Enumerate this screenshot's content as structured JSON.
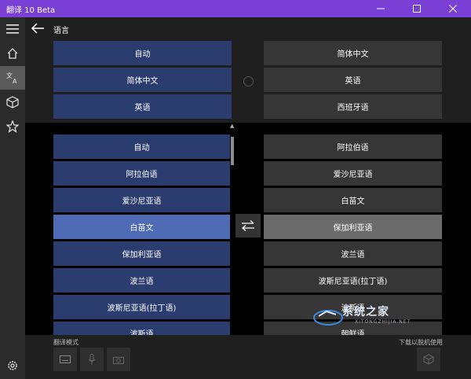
{
  "window": {
    "title": "翻译 10 Beta"
  },
  "header": {
    "title": "语言"
  },
  "top": {
    "source": [
      "自动",
      "简体中文",
      "英语"
    ],
    "target": [
      "简体中文",
      "英语",
      "西班牙语"
    ]
  },
  "source_list": {
    "items": [
      "自动",
      "阿拉伯语",
      "爱沙尼亚语",
      "白苗文",
      "保加利亚语",
      "波兰语",
      "波斯尼亚语(拉丁语)",
      "波斯语"
    ],
    "selected": "白苗文"
  },
  "target_list": {
    "items": [
      "阿拉伯语",
      "爱沙尼亚语",
      "白苗文",
      "保加利亚语",
      "波兰语",
      "波斯尼亚语(拉丁语)",
      "波斯语",
      "朝鲜语"
    ],
    "selected": "保加利亚语"
  },
  "bottom": {
    "mode_label": "翻译模式",
    "download_label": "下载以脱机使用"
  },
  "watermark": {
    "text": "系统之家",
    "sub": "XITONGZHIJIA.NET"
  },
  "colors": {
    "titlebar": "#7a40d6",
    "blue": "#2b3c6e",
    "blue_selected": "#4f6bb5",
    "gray": "#363636",
    "gray_selected": "#6b6b6b"
  }
}
